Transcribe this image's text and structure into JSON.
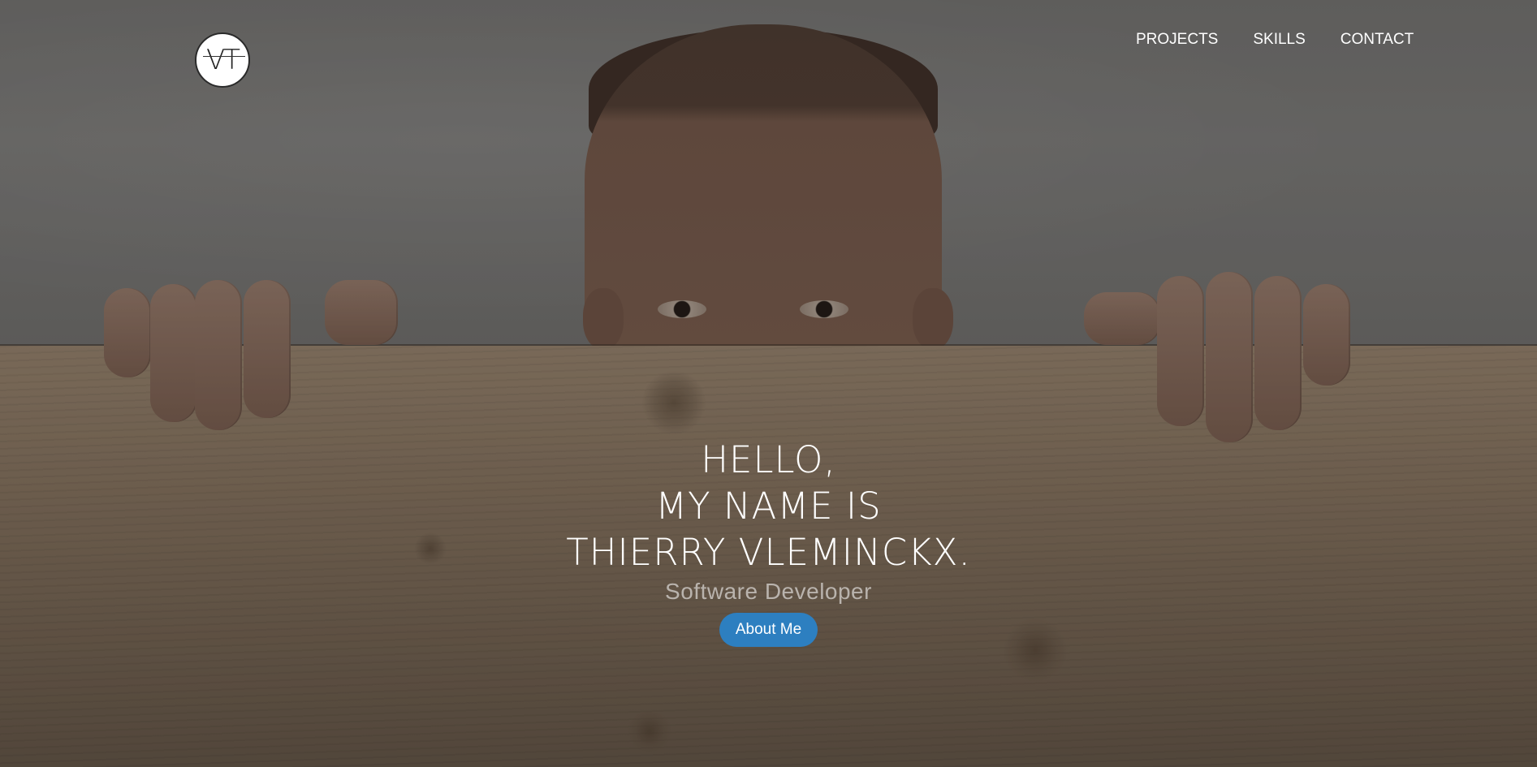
{
  "logo": {
    "text": "VT"
  },
  "nav": {
    "items": [
      {
        "label": "PROJECTS"
      },
      {
        "label": "SKILLS"
      },
      {
        "label": "CONTACT"
      }
    ]
  },
  "hero": {
    "line1": "HELLO,",
    "line2": "MY NAME IS",
    "line3": "THIERRY VLEMINCKX.",
    "subtitle": "Software Developer",
    "button_label": "About Me"
  },
  "colors": {
    "accent": "#2d7fc0",
    "text": "#ffffff",
    "subtitle": "#b9b3ad"
  }
}
